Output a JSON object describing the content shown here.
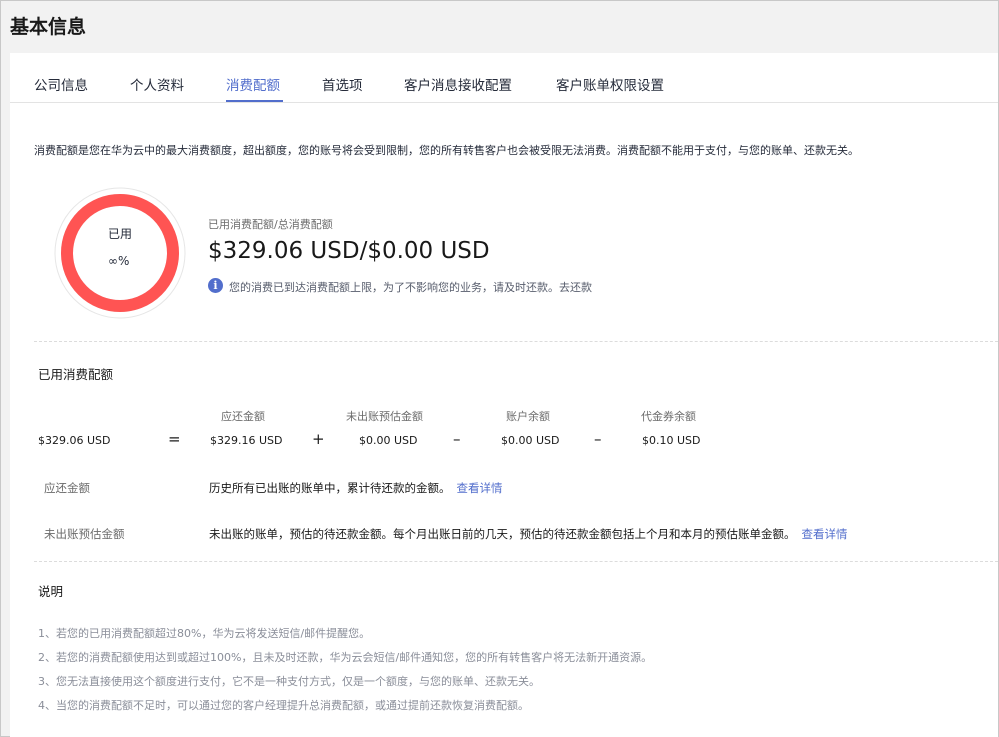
{
  "page": {
    "title": "基本信息"
  },
  "tabs": [
    {
      "label": "公司信息"
    },
    {
      "label": "个人资料"
    },
    {
      "label": "消费配额"
    },
    {
      "label": "首选项"
    },
    {
      "label": "客户消息接收配置"
    },
    {
      "label": "客户账单权限设置"
    }
  ],
  "active_tab": "消费配额",
  "description": "消费配额是您在华为云中的最大消费额度，超出额度，您的账号将会受到限制，您的所有转售客户也会被受限无法消费。消费配额不能用于支付，与您的账单、还款无关。",
  "usage_ring": {
    "label": "已用",
    "percent_text": "∞%",
    "color": "#ff5453",
    "track_color": "#e6e6e6",
    "used_fraction": 1
  },
  "summary": {
    "subtitle": "已用消费配额/总消费配额",
    "amount": "$329.06 USD/$0.00 USD",
    "notice": "您的消费已到达消费配额上限，为了不影响您的业务，请及时还款。去还款"
  },
  "used_quota": {
    "title": "已用消费配额",
    "total": "$329.06 USD",
    "equals": "=",
    "columns": [
      {
        "header": "应还金额",
        "value": "$329.16 USD"
      },
      {
        "header": "未出账预估金额",
        "value": "$0.00 USD"
      },
      {
        "header": "账户余额",
        "value": "$0.00 USD"
      },
      {
        "header": "代金券余额",
        "value": "$0.10 USD"
      }
    ],
    "operators": [
      "+",
      "–",
      "–"
    ]
  },
  "details": [
    {
      "label": "应还金额",
      "text": "历史所有已出账的账单中，累计待还款的金额。",
      "link": "查看详情"
    },
    {
      "label": "未出账预估金额",
      "text": "未出账的账单，预估的待还款金额。每个月出账日前的几天，预估的待还款金额包括上个月和本月的预估账单金额。",
      "link": "查看详情"
    }
  ],
  "notes": {
    "title": "说明",
    "items": [
      "1、若您的已用消费配额超过80%，华为云将发送短信/邮件提醒您。",
      "2、若您的消费配额使用达到或超过100%，且未及时还款，华为云会短信/邮件通知您，您的所有转售客户将无法新开通资源。",
      "3、您无法直接使用这个额度进行支付，它不是一种支付方式，仅是一个额度，与您的账单、还款无关。",
      "4、当您的消费配额不足时，可以通过您的客户经理提升总消费配额，或通过提前还款恢复消费配额。"
    ]
  }
}
